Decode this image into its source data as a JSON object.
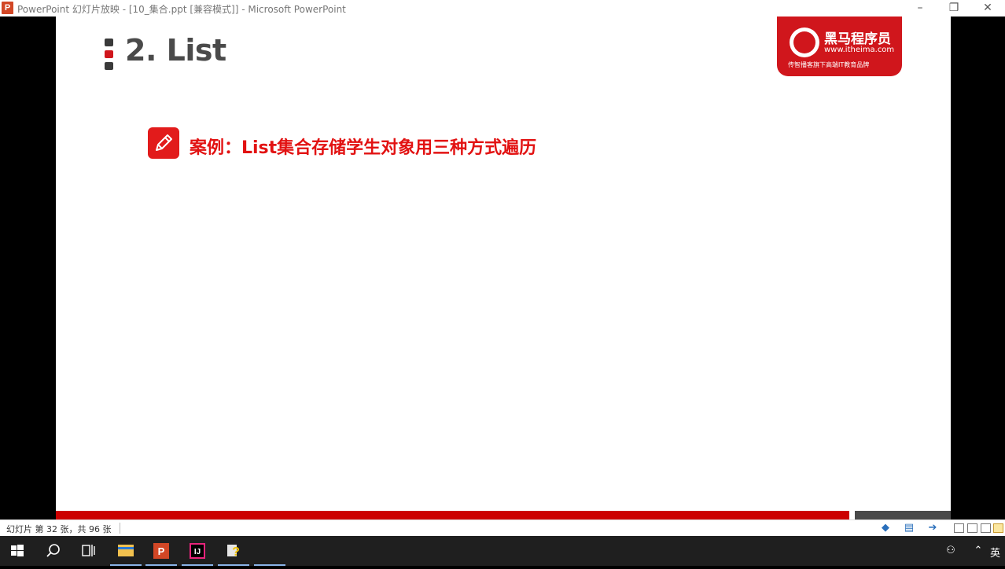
{
  "window": {
    "title": "PowerPoint 幻灯片放映 - [10_集合.ppt [兼容模式]] - Microsoft PowerPoint",
    "app_icon_letter": "P",
    "minimize": "–",
    "restore": "❐",
    "close": "✕"
  },
  "slide": {
    "title": "2. List",
    "logo": {
      "brand": "黑马程序员",
      "url": "www.itheima.com",
      "slogan": "传智播客旗下高端IT教育品牌"
    },
    "case_heading": "案例：List集合存储学生对象用三种方式遍历"
  },
  "statusbar": {
    "slide_info": "幻灯片 第 32 张，共 96 张"
  },
  "taskbar": {
    "language": "英",
    "active_underline_color": "#8ab4e8"
  },
  "colors": {
    "accent_red": "#e21212",
    "logo_red": "#d0161c",
    "title_gray": "#4a4a4a"
  }
}
